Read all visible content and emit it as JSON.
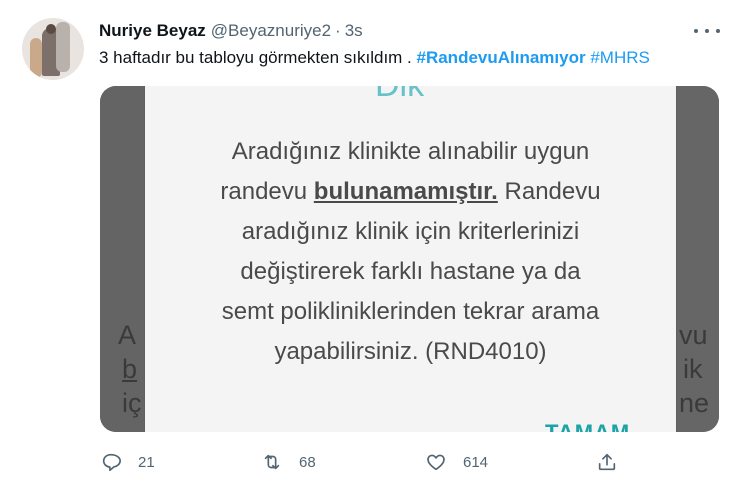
{
  "tweet": {
    "author_name": "Nuriye Beyaz",
    "handle": "@Beyaznuriye2",
    "separator": "·",
    "time": "3s",
    "text_plain": "3 haftadır bu tabloyu görmekten sıkıldım . ",
    "hashtag_1": "#RandevuAlınamıyor",
    "hashtag_2": "#MHRS"
  },
  "media": {
    "dialog_top_fragment": "Dik",
    "line_1": "Aradığınız klinikte alınabilir uygun",
    "line_2_start": "randevu ",
    "line_2_bold": "bulunamamıştır.",
    "line_2_end": " Randevu",
    "line_3": "aradığınız klinik için kriterlerinizi",
    "line_4": "değiştirerek farklı hastane ya da",
    "line_5": "semt polikliniklerinden tekrar arama",
    "line_6": "yapabilirsiniz. (RND4010)",
    "ok_button": "TAMAM",
    "bg_left_1": "A",
    "bg_left_2": "b",
    "bg_left_3": "iç",
    "bg_right_1": "vu",
    "bg_right_2": "ik",
    "bg_right_3": "ne"
  },
  "actions": {
    "replies": "21",
    "retweets": "68",
    "likes": "614"
  },
  "colors": {
    "accent": "#1d9bf0",
    "secondary_text": "#536471",
    "dialog_accent": "#1aa3a8"
  },
  "icons": [
    "more-icon",
    "reply-icon",
    "retweet-icon",
    "like-icon",
    "share-icon"
  ]
}
